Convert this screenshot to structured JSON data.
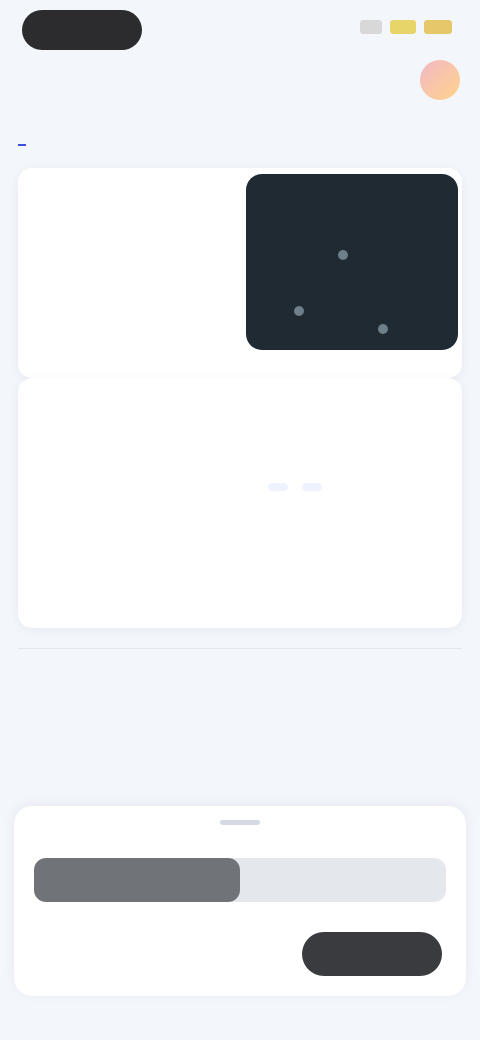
{
  "status": {
    "signal_colors": [
      "#cfcfcf",
      "#e8d56a",
      "#e5c86a"
    ]
  },
  "header": {
    "title": "",
    "avatar_colors": [
      "#f2b8c6",
      "#ffd38a"
    ]
  },
  "tabs": [
    {
      "label": ""
    },
    {
      "label": ""
    },
    {
      "label": ""
    },
    {
      "label": ""
    },
    {
      "label": ""
    }
  ],
  "card1": {
    "lines": [
      "",
      "",
      ""
    ],
    "dark_panel_icon": "dot-icon"
  },
  "card2": {
    "title": "",
    "link": "",
    "left_title": "",
    "left_values": [
      "",
      ""
    ],
    "right_pills": [
      "",
      ""
    ],
    "right_note": ""
  },
  "info_line": {
    "left": "",
    "right": ""
  },
  "section": {
    "title": "",
    "link": ""
  },
  "bottom_sheet": {
    "progress_fraction": 0.5,
    "note": "",
    "cta_label": ""
  }
}
